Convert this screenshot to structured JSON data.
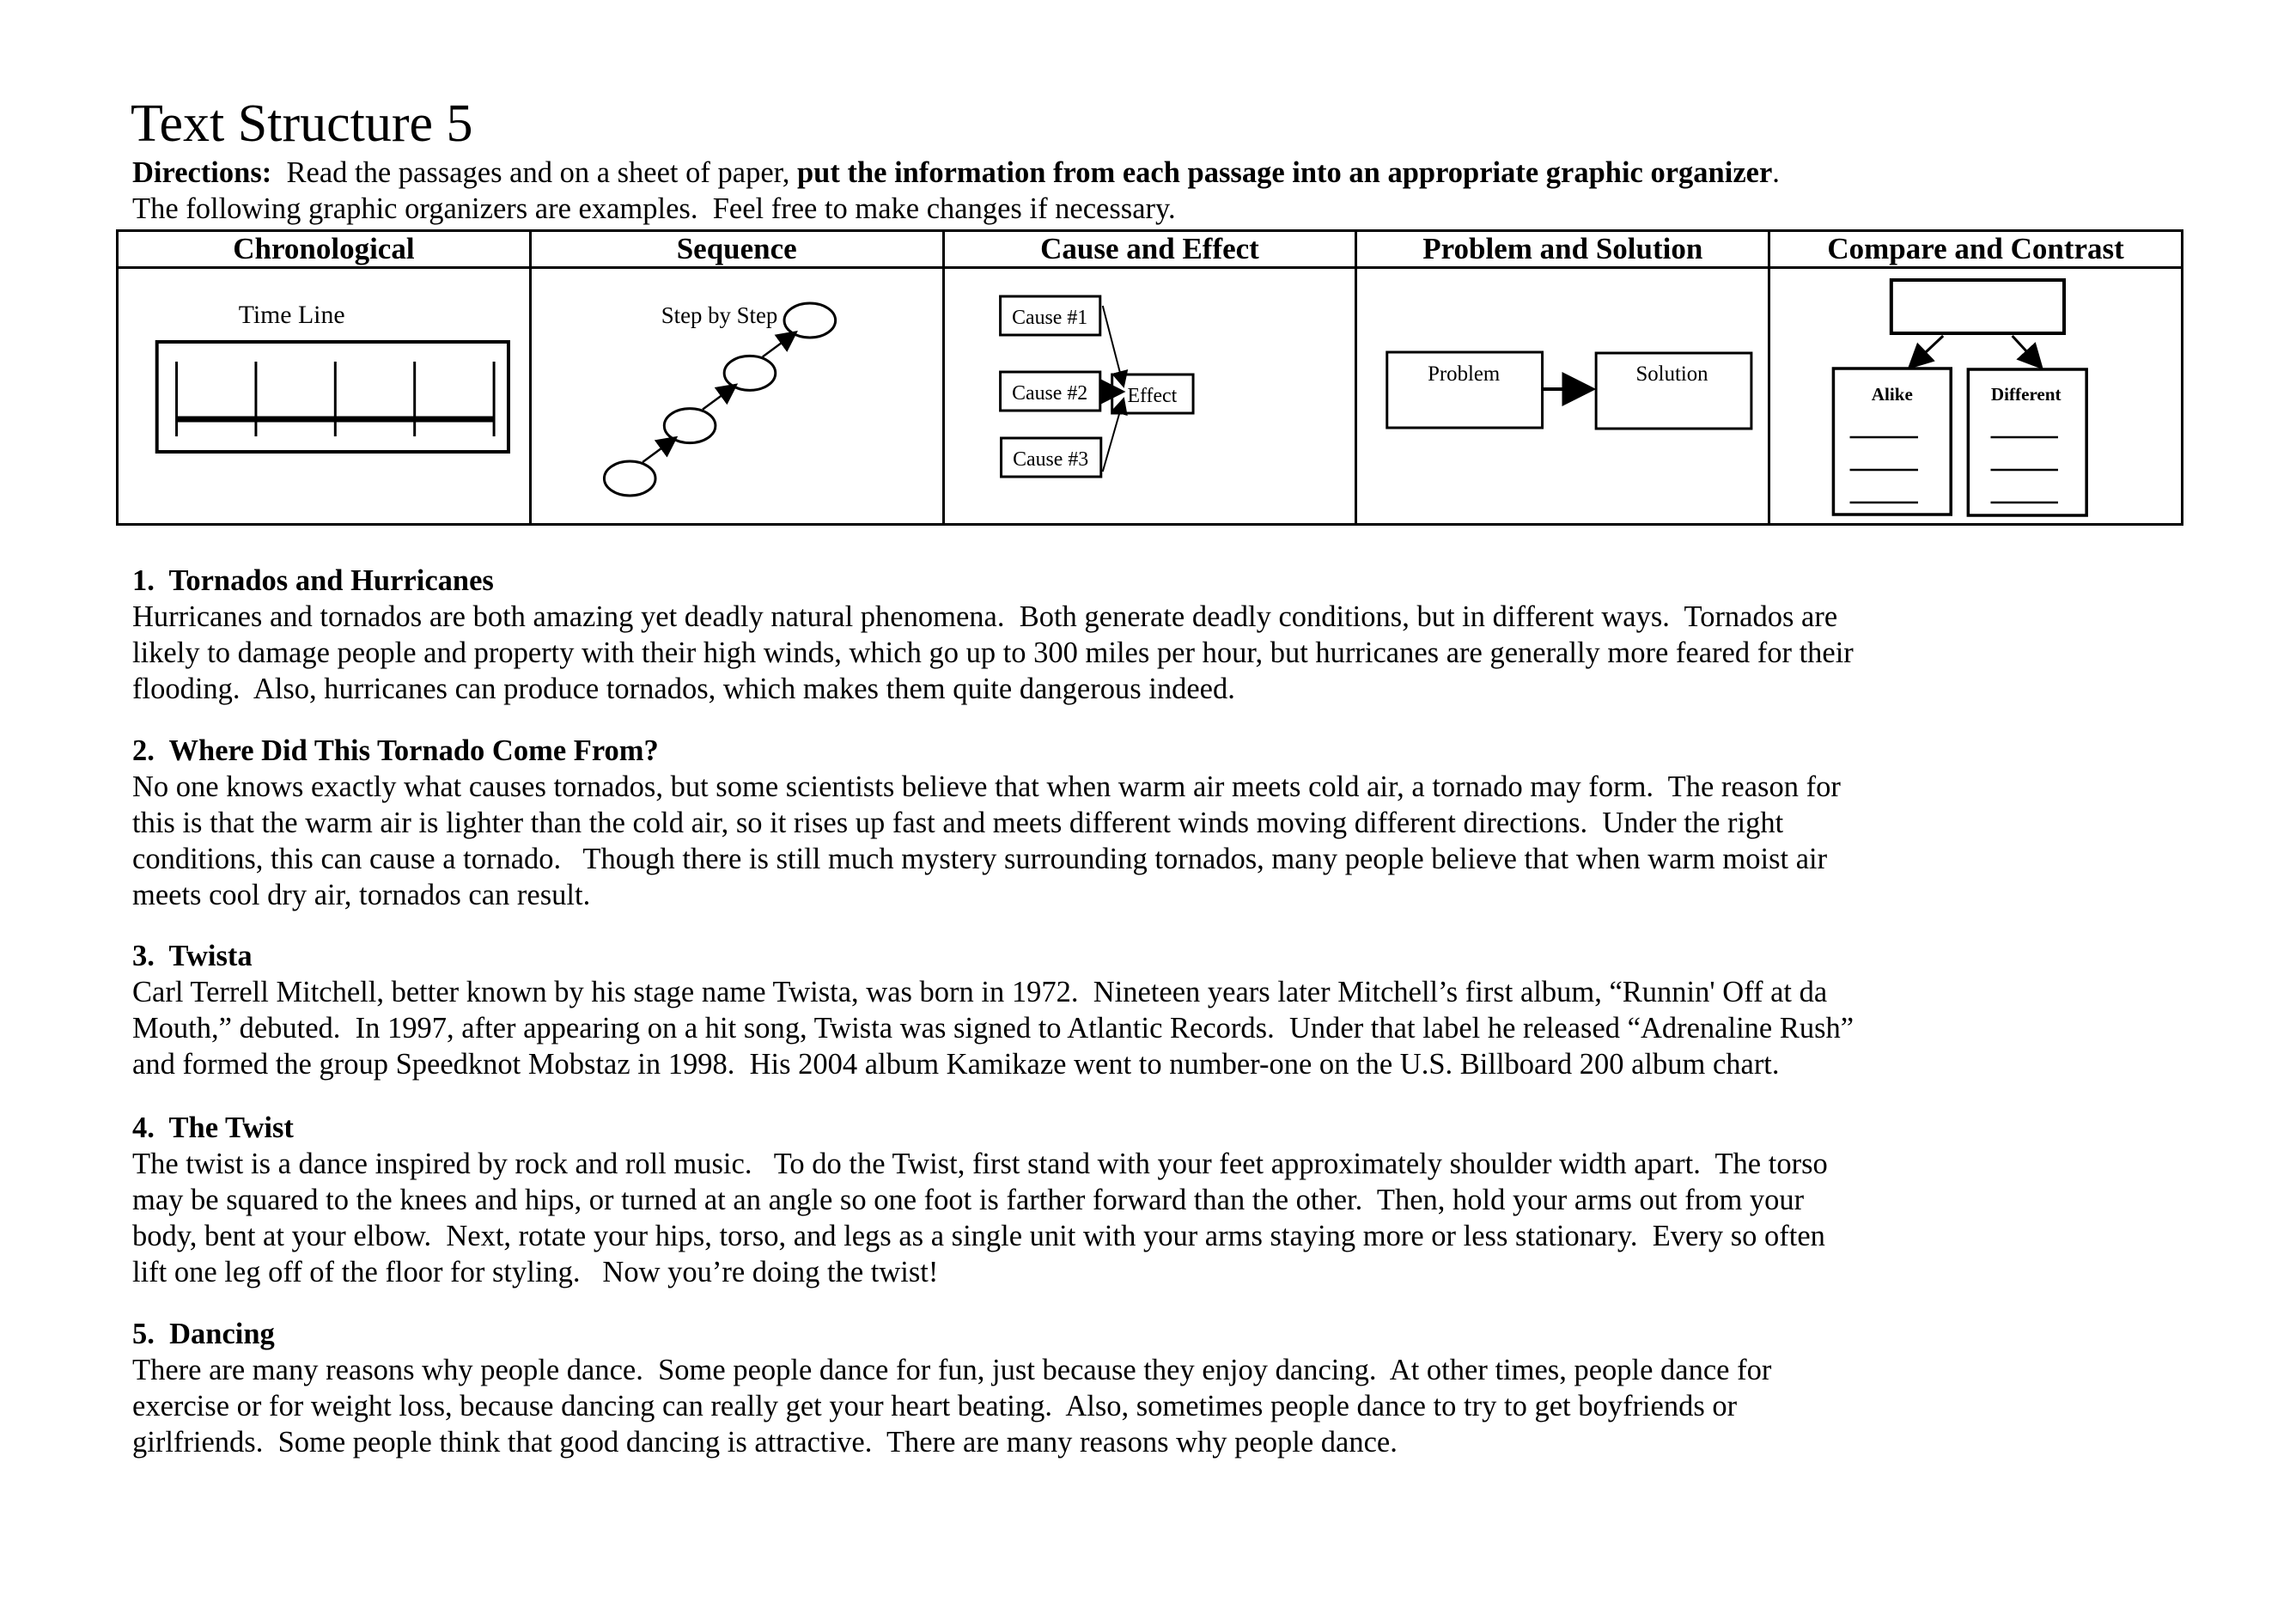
{
  "title": "Text Structure 5",
  "directions": {
    "label": "Directions:",
    "text_before": "  Read the passages and on a sheet of paper, ",
    "bold_text": "put the information from each passage into an appropriate graphic organizer",
    "text_after": ".",
    "line2": "The following graphic organizers are examples.  Feel free to make changes if necessary."
  },
  "organizers": {
    "headers": [
      "Chronological",
      "Sequence",
      "Cause and Effect",
      "Problem and Solution",
      "Compare and Contrast"
    ],
    "chronological": {
      "label": "Time Line",
      "tick_count": 5
    },
    "sequence": {
      "label": "Step by Step",
      "step_count": 4
    },
    "cause_effect": {
      "causes": [
        "Cause #1",
        "Cause #2",
        "Cause #3"
      ],
      "effect": "Effect"
    },
    "problem_solution": {
      "problem": "Problem",
      "solution": "Solution"
    },
    "compare_contrast": {
      "alike": "Alike",
      "different": "Different",
      "blank_lines": 3
    }
  },
  "passages": [
    {
      "heading": "1.  Tornados and Hurricanes",
      "lines": [
        "Hurricanes and tornados are both amazing yet deadly natural phenomena.  Both generate deadly conditions, but in different ways.  Tornados are",
        "likely to damage people and property with their high winds, which go up to 300 miles per hour, but hurricanes are generally more feared for their",
        "flooding.  Also, hurricanes can produce tornados, which makes them quite dangerous indeed."
      ]
    },
    {
      "heading": "2.  Where Did This Tornado Come From?",
      "lines": [
        "No one knows exactly what causes tornados, but some scientists believe that when warm air meets cold air, a tornado may form.  The reason for",
        "this is that the warm air is lighter than the cold air, so it rises up fast and meets different winds moving different directions.  Under the right",
        "conditions, this can cause a tornado.   Though there is still much mystery surrounding tornados, many people believe that when warm moist air",
        "meets cool dry air, tornados can result."
      ]
    },
    {
      "heading": "3.  Twista",
      "lines": [
        "Carl Terrell Mitchell, better known by his stage name Twista, was born in 1972.  Nineteen years later Mitchell’s first album, “Runnin' Off at da",
        "Mouth,” debuted.  In 1997, after appearing on a hit song, Twista was signed to Atlantic Records.  Under that label he released “Adrenaline Rush”",
        "and formed the group Speedknot Mobstaz in 1998.  His 2004 album Kamikaze went to number-one on the U.S. Billboard 200 album chart."
      ]
    },
    {
      "heading": "4.  The Twist",
      "lines": [
        "The twist is a dance inspired by rock and roll music.   To do the Twist, first stand with your feet approximately shoulder width apart.  The torso",
        "may be squared to the knees and hips, or turned at an angle so one foot is farther forward than the other.  Then, hold your arms out from your",
        "body, bent at your elbow.  Next, rotate your hips, torso, and legs as a single unit with your arms staying more or less stationary.  Every so often",
        "lift one leg off of the floor for styling.   Now you’re doing the twist!"
      ]
    },
    {
      "heading": "5.  Dancing",
      "lines": [
        "There are many reasons why people dance.  Some people dance for fun, just because they enjoy dancing.  At other times, people dance for",
        "exercise or for weight loss, because dancing can really get your heart beating.  Also, sometimes people dance to try to get boyfriends or",
        "girlfriends.  Some people think that good dancing is attractive.  There are many reasons why people dance."
      ]
    }
  ]
}
